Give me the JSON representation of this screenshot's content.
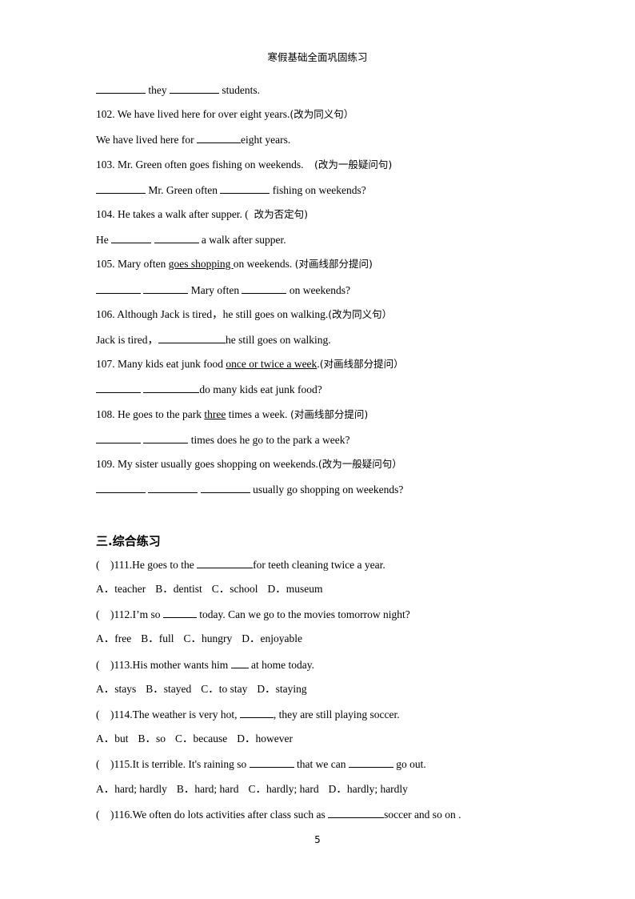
{
  "header": {
    "title": "寒假基础全面巩固练习"
  },
  "items": {
    "l101_answer": {
      "mid": " they ",
      "end": " students."
    },
    "q102": {
      "text": "102. We have lived here for over eight years.",
      "note": "(改为同义句）"
    },
    "a102": {
      "start": "We have lived here for ",
      "end": "eight years."
    },
    "q103": {
      "text": "103. Mr. Green often goes fishing on weekends.    ",
      "note": "(改为一般疑问句)"
    },
    "a103": {
      "mid": " Mr. Green often ",
      "end": " fishing on weekends?"
    },
    "q104": {
      "text": "104. He takes a walk after supper. (  ",
      "note": "改为否定句)"
    },
    "a104": {
      "start": "He ",
      "end": " a walk after supper."
    },
    "q105": {
      "start": "105. Mary often ",
      "underlined": "goes shopping ",
      "end": "on weekends. ",
      "note": "(对画线部分提问)"
    },
    "a105": {
      "mid": " Mary often ",
      "end": " on weekends?"
    },
    "q106": {
      "text": "106. Although Jack is tired，he still goes on walking.",
      "note": "(改为同义句）"
    },
    "a106": {
      "start": "Jack is tired，",
      "end": "he still goes on walking."
    },
    "q107": {
      "start": "107. Many kids eat junk food ",
      "underlined": "once or twice a week",
      "end": ".",
      "note": "(对画线部分提问）"
    },
    "a107": {
      "end": "do many kids eat junk food?"
    },
    "q108": {
      "start": "108. He goes to the park ",
      "underlined": "three",
      "end": " times a week. ",
      "note": "(对画线部分提问)"
    },
    "a108": {
      "end": " times does he go to the park a week?"
    },
    "q109": {
      "text": "109. My sister usually goes shopping on weekends.",
      "note": "(改为一般疑问句）"
    },
    "a109": {
      "end": " usually go shopping on weekends?"
    }
  },
  "section3": {
    "title": "三.综合练习"
  },
  "mc": [
    {
      "prefix": "(    )111.He goes to the ",
      "suffix": "for teeth cleaning twice a year.",
      "options": [
        "A．teacher",
        "B．dentist",
        "C．school",
        "D．museum"
      ]
    },
    {
      "prefix": "(    )112.I’m so ",
      "suffix": " today. Can we go to the movies tomorrow night?",
      "options": [
        "A．free",
        "B．full",
        "C．hungry",
        "D．enjoyable"
      ]
    },
    {
      "prefix": "(    )113.His mother wants him ",
      "suffix": " at home today.",
      "options": [
        "A．stays",
        "B．stayed",
        "C．to stay",
        "D．staying"
      ]
    },
    {
      "prefix": "(    )114.The weather is very hot, ",
      "suffix": ", they are still playing soccer.",
      "options": [
        "A．but",
        "B．so",
        "C．because",
        "D．however"
      ]
    },
    {
      "prefix": "(    )115.It is terrible. It's raining so ",
      "mid": " that we can ",
      "suffix": " go out.",
      "options": [
        "A．hard; hardly",
        "B．hard; hard",
        "C．hardly; hard",
        "D．hardly; hardly"
      ]
    },
    {
      "prefix": "(    )116.We often do lots activities after class such as ",
      "suffix": "soccer and so on ."
    }
  ],
  "footer": {
    "page_number": "5"
  }
}
